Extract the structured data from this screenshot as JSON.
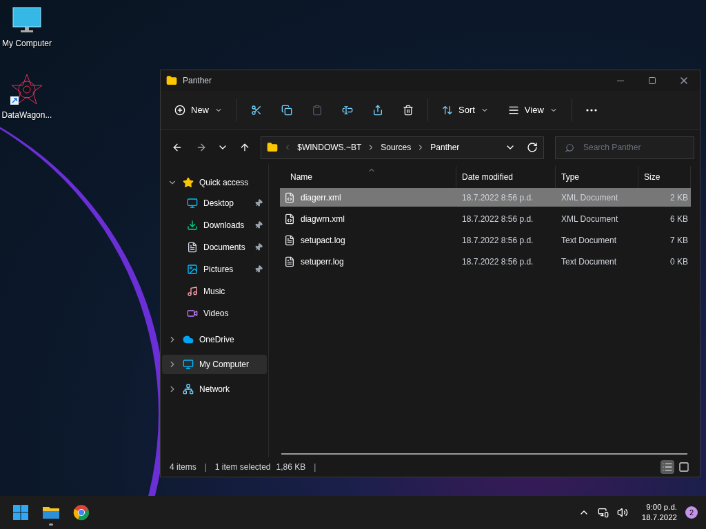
{
  "desktop_icons": [
    {
      "label": "My Computer",
      "kind": "computer"
    },
    {
      "label": "DataWagon...",
      "kind": "app"
    }
  ],
  "window": {
    "title": "Panther"
  },
  "toolbar": {
    "new": "New",
    "sort": "Sort",
    "view": "View",
    "paste_disabled": true
  },
  "nav": {
    "path": [
      "$WINDOWS.~BT",
      "Sources",
      "Panther"
    ],
    "search": {
      "placeholder": "Search Panther"
    }
  },
  "sidebar": {
    "items": [
      {
        "label": "Quick access",
        "kind": "star",
        "expanded": true,
        "selected": false,
        "children": [
          {
            "label": "Desktop",
            "kind": "desktop",
            "pinned": true
          },
          {
            "label": "Downloads",
            "kind": "downloads",
            "pinned": true
          },
          {
            "label": "Documents",
            "kind": "documents",
            "pinned": true
          },
          {
            "label": "Pictures",
            "kind": "pictures",
            "pinned": true
          },
          {
            "label": "Music",
            "kind": "music",
            "pinned": false
          },
          {
            "label": "Videos",
            "kind": "videos",
            "pinned": false
          }
        ]
      },
      {
        "label": "OneDrive",
        "kind": "cloud",
        "expanded": false,
        "selected": false
      },
      {
        "label": "My Computer",
        "kind": "computer",
        "expanded": false,
        "selected": true
      },
      {
        "label": "Network",
        "kind": "network",
        "expanded": false,
        "selected": false
      }
    ]
  },
  "table": {
    "columns": [
      "Name",
      "Date modified",
      "Type",
      "Size"
    ],
    "rows": [
      {
        "name": "diagerr.xml",
        "kind": "xml",
        "date": "18.7.2022 8:56 p.d.",
        "type": "XML Document",
        "size": "2 KB",
        "selected": true
      },
      {
        "name": "diagwrn.xml",
        "kind": "xml",
        "date": "18.7.2022 8:56 p.d.",
        "type": "XML Document",
        "size": "6 KB",
        "selected": false
      },
      {
        "name": "setupact.log",
        "kind": "text",
        "date": "18.7.2022 8:56 p.d.",
        "type": "Text Document",
        "size": "7 KB",
        "selected": false
      },
      {
        "name": "setuperr.log",
        "kind": "text",
        "date": "18.7.2022 8:56 p.d.",
        "type": "Text Document",
        "size": "0 KB",
        "selected": false
      }
    ]
  },
  "status_bar": {
    "separators": [
      "|",
      "|"
    ],
    "count": "4 items",
    "selection": "1 item selected",
    "size": "1,86 KB",
    "views": [
      {
        "kind": "details",
        "selected": true
      },
      {
        "kind": "tiles",
        "selected": false
      }
    ]
  },
  "taskbar": {
    "apps": [
      {
        "kind": "start",
        "running": false
      },
      {
        "kind": "explorer",
        "running": true
      },
      {
        "kind": "browser",
        "running": false
      }
    ],
    "time": "9:00 p.d.",
    "date": "18.7.2022",
    "notifications": "2"
  }
}
